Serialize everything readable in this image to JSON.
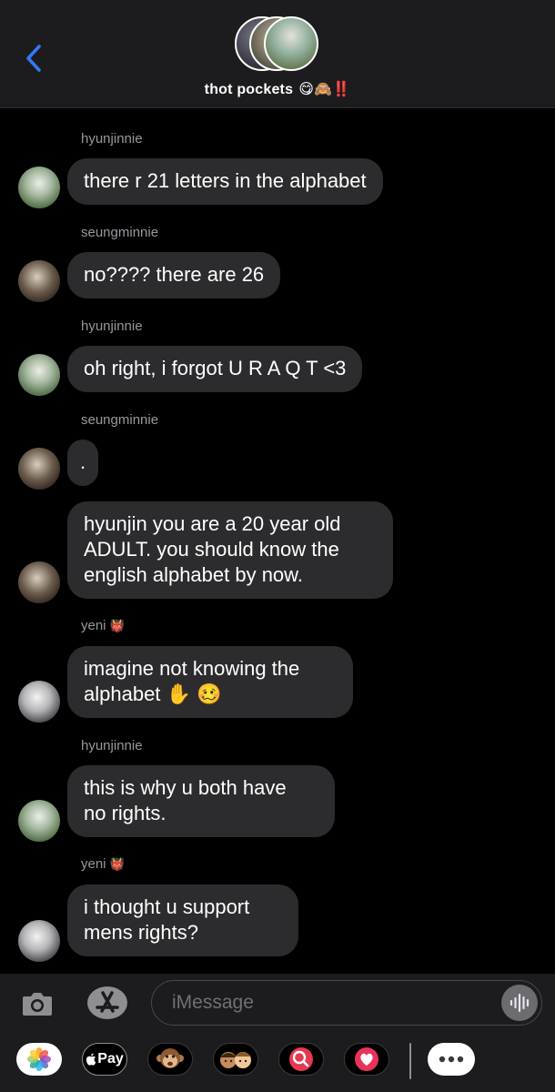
{
  "header": {
    "back_icon": "chevron-left-icon",
    "title": "thot pockets",
    "title_emojis": "😋🙈‼️"
  },
  "messages": [
    {
      "sender": "hyunjinnie",
      "text": "there r 21 letters in the alphabet"
    },
    {
      "sender": "seungminnie",
      "text": "no???? there are 26"
    },
    {
      "sender": "hyunjinnie",
      "text": "oh right, i forgot U R A Q T <3"
    },
    {
      "sender": "seungminnie",
      "text": "."
    },
    {
      "sender": "",
      "text_line1": "hyunjin you are a 20 year old",
      "text_line2": "ADULT. you should know the",
      "text_line3": "english alphabet by now."
    },
    {
      "sender": "yeni",
      "sender_emoji": "👹",
      "text_line1": "imagine not knowing the",
      "text_line2": "alphabet ✋ 🥴"
    },
    {
      "sender": "hyunjinnie",
      "text_line1": "this is why u both have",
      "text_line2": "no rights."
    },
    {
      "sender": "yeni",
      "sender_emoji": "👹",
      "text_line1": "i thought u support",
      "text_line2": "mens rights?"
    }
  ],
  "compose": {
    "placeholder": "iMessage",
    "camera_icon": "camera-icon",
    "appstore_icon": "app-store-icon",
    "audio_icon": "waveform-icon"
  },
  "app_drawer": {
    "apple_pay_label": "Pay",
    "apps": [
      "photos-icon",
      "apple-pay-icon",
      "monkey-animoji-icon",
      "memoji-icon",
      "web-search-icon",
      "digital-touch-icon",
      "more-icon"
    ]
  },
  "colors": {
    "bubble": "#2c2c2e",
    "header_bg": "#1c1c1e",
    "accent_blue": "#3478f6",
    "name_gray": "#98989f"
  }
}
